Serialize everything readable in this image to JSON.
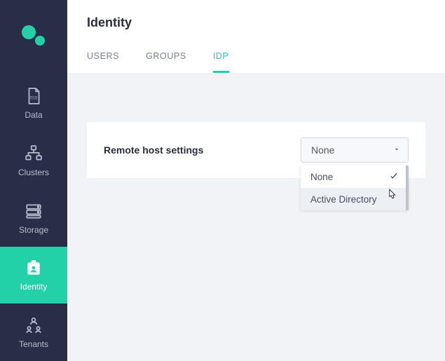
{
  "page": {
    "title": "Identity"
  },
  "sidebar": {
    "items": [
      {
        "label": "Data",
        "icon": "data-file-icon"
      },
      {
        "label": "Clusters",
        "icon": "clusters-icon"
      },
      {
        "label": "Storage",
        "icon": "storage-icon"
      },
      {
        "label": "Identity",
        "icon": "identity-card-icon"
      },
      {
        "label": "Tenants",
        "icon": "tenants-icon"
      }
    ],
    "active_index": 3
  },
  "tabs": {
    "items": [
      "USERS",
      "GROUPS",
      "IDP"
    ],
    "active_index": 2
  },
  "settings": {
    "remote_host_label": "Remote host settings",
    "select_value": "None",
    "dropdown": {
      "option_none": "None",
      "option_ad": "Active Directory",
      "selected_index": 0,
      "hover_index": 1
    }
  },
  "colors": {
    "accent": "#23d1a9",
    "sidebar_bg": "#2a2d47",
    "page_bg": "#f1f3f6"
  }
}
